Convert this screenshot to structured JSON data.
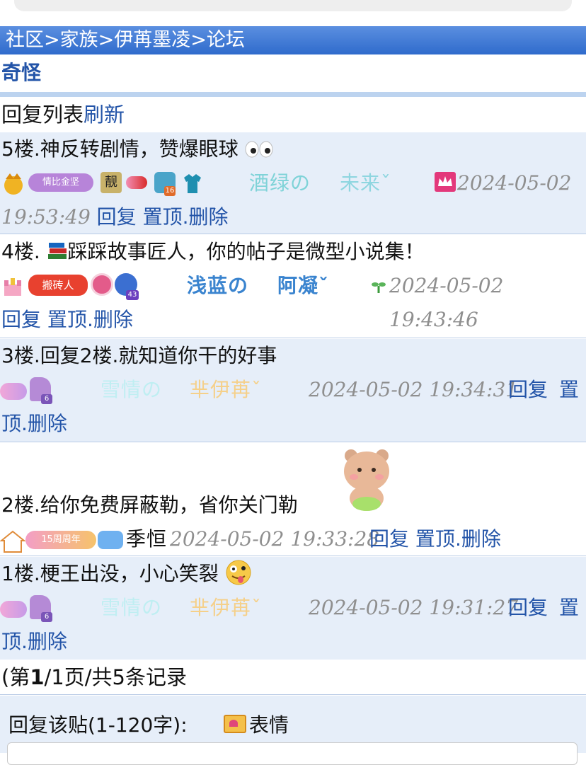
{
  "breadcrumb": {
    "items": [
      "社区",
      "家族",
      "伊苒墨凌",
      "论坛"
    ],
    "separator": ">"
  },
  "thread_title": "奇怪",
  "list_header": {
    "label": "回复列表",
    "refresh": "刷新"
  },
  "actions": {
    "reply": "回复",
    "pin": "置顶",
    "dot": ".",
    "delete": "删除"
  },
  "posts": [
    {
      "floor": "5楼.",
      "text": "神反转剧情，赞爆眼球",
      "name_a": "酒绿の",
      "name_b": "未来ˇ",
      "date": "2024-05-02",
      "time": "19:53:49"
    },
    {
      "floor": "4楼.",
      "text": "踩踩故事匠人，你的帖子是微型小说集！",
      "name_a": "浅蓝の",
      "name_b": "阿凝ˇ",
      "datetime": "2024-05-02 19:43:46"
    },
    {
      "floor": "3楼.",
      "text": "回复2楼.就知道你干的好事",
      "name_a": "雪情の",
      "name_b": "芈伊苒ˇ",
      "datetime": "2024-05-02 19:34:31"
    },
    {
      "floor": "2楼.",
      "text": "给你免费屏蔽勒，省你关门勒",
      "name": "季恒",
      "datetime": "2024-05-02 19:33:28"
    },
    {
      "floor": "1楼.",
      "text": "梗王出没，小心笑裂",
      "name_a": "雪情の",
      "name_b": "芈伊苒ˇ",
      "datetime": "2024-05-02 19:31:27"
    }
  ],
  "badges": {
    "b1": "情比金坚",
    "b2": "搬砖人",
    "b3": "15周周年",
    "b4": "靓",
    "n16": "16",
    "n43": "43",
    "n6": "6"
  },
  "pagination": {
    "open": "(第",
    "current": "1",
    "rest": "/1页/共5条记录"
  },
  "reply_form": {
    "label": "回复该贴(1-120字):",
    "emoji": "表情"
  },
  "colors": {
    "header_bg": "#3f7bd6",
    "link": "#2354a8",
    "row_alt": "#e6eef9"
  }
}
